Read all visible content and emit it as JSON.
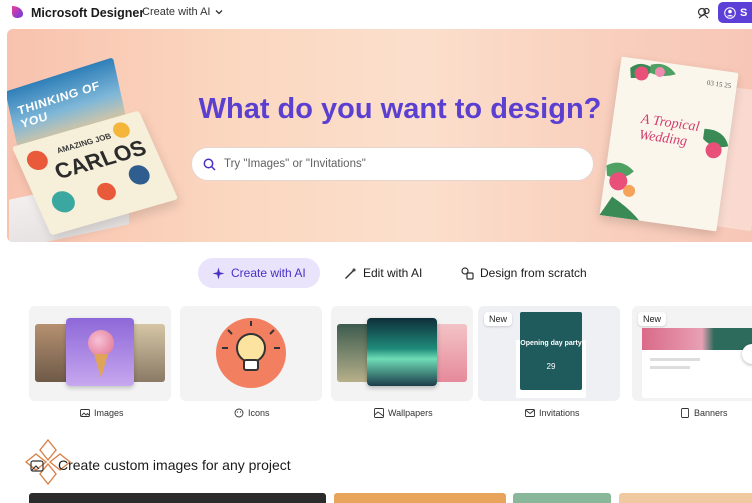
{
  "header": {
    "brand": "Microsoft Designer",
    "menu_label": "Create with AI",
    "signin_label": "S"
  },
  "hero": {
    "title": "What do you want to design?",
    "search_placeholder": "Try \"Images\" or \"Invitations\"",
    "card_thinking": "THINKING OF YOU",
    "card_carlos_line1": "AMAZING JOB",
    "card_carlos_line2": "CARLOS",
    "wedding_date": "03 15 25",
    "wedding_title": "A Tropical Wedding"
  },
  "tabs": [
    {
      "label": "Create with AI",
      "active": true
    },
    {
      "label": "Edit with AI",
      "active": false
    },
    {
      "label": "Design from scratch",
      "active": false
    }
  ],
  "categories": [
    {
      "label": "Images",
      "badge": ""
    },
    {
      "label": "Icons",
      "badge": ""
    },
    {
      "label": "Wallpapers",
      "badge": ""
    },
    {
      "label": "Invitations",
      "badge": "New",
      "preview_title": "Opening day party",
      "preview_date": "29"
    },
    {
      "label": "Banners",
      "badge": "New"
    }
  ],
  "section": {
    "title": "Create custom images for any project"
  },
  "colors": {
    "accent": "#5a3fd1",
    "tab_active_bg": "#e9e3fb"
  }
}
